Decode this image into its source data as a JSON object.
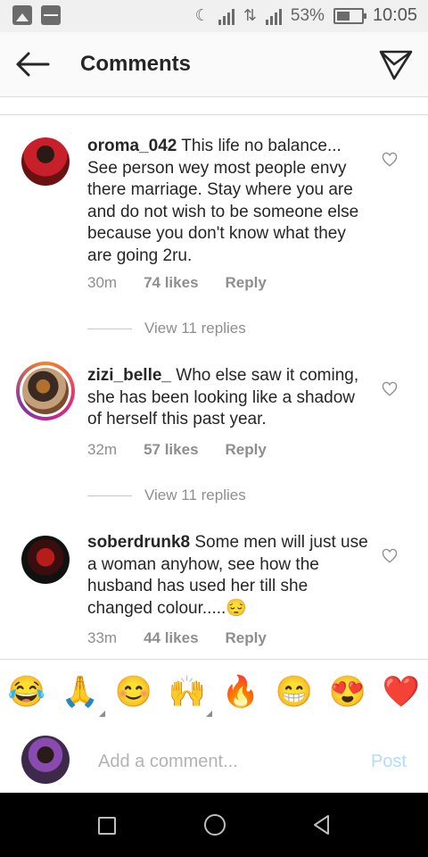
{
  "status_bar": {
    "battery": "53%",
    "time": "10:05"
  },
  "header": {
    "title": "Comments"
  },
  "comments": [
    {
      "username": "oroma_042",
      "text": "This life no balance... See person wey most people envy there marriage. Stay where you are and do not wish to be someone else because you don't know what they are going 2ru.",
      "time": "30m",
      "likes": "74 likes",
      "reply": "Reply",
      "view_replies": "View 11 replies"
    },
    {
      "username": "zizi_belle_",
      "text": "Who else saw it coming,  she has been looking like a shadow of herself this past year.",
      "time": "32m",
      "likes": "57 likes",
      "reply": "Reply",
      "view_replies": "View 11 replies"
    },
    {
      "username": "soberdrunk8",
      "text": "Some men will just use a woman anyhow, see how the husband has used her till she changed colour.....😔",
      "time": "33m",
      "likes": "44 likes",
      "reply": "Reply"
    }
  ],
  "emoji_bar": [
    "😂",
    "🙏",
    "😊",
    "🙌",
    "🔥",
    "😁",
    "😍",
    "❤️"
  ],
  "add_comment": {
    "placeholder": "Add a comment...",
    "post_label": "Post"
  },
  "icons": {
    "back": "back-arrow-icon",
    "send": "direct-send-icon",
    "like": "heart-outline-icon"
  },
  "colors": {
    "post_disabled": "#b3dbff",
    "secondary_text": "#8e8e8e"
  }
}
